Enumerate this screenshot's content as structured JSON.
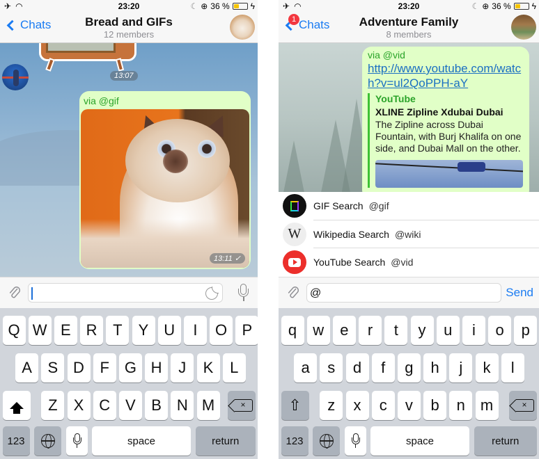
{
  "status_bar": {
    "time": "23:20",
    "battery_text": "36 %",
    "battery_level": 0.36,
    "icons": [
      "airplane-icon",
      "wifi-icon",
      "moon-icon",
      "orientation-lock-icon",
      "battery-icon",
      "charging-icon"
    ]
  },
  "colors": {
    "accent": "#1b7cf2",
    "bubble_out": "#e1ffc7",
    "via_green": "#2aa329",
    "link": "#1b6fc2",
    "badge": "#f3373f",
    "keyboard_bg": "#d1d5db"
  },
  "left": {
    "nav": {
      "back_label": "Chats",
      "title": "Bread and GIFs",
      "subtitle": "12 members"
    },
    "messages": [
      {
        "type": "sticker",
        "time": "13:07"
      },
      {
        "type": "gif",
        "via": "via @gif",
        "time": "13:11",
        "status": "sent-check"
      }
    ],
    "input": {
      "value": "",
      "placeholder": ""
    },
    "keyboard": {
      "row1": [
        "Q",
        "W",
        "E",
        "R",
        "T",
        "Y",
        "U",
        "I",
        "O",
        "P"
      ],
      "row2": [
        "A",
        "S",
        "D",
        "F",
        "G",
        "H",
        "J",
        "K",
        "L"
      ],
      "row3": [
        "Z",
        "X",
        "C",
        "V",
        "B",
        "N",
        "M"
      ],
      "numbers_label": "123",
      "space_label": "space",
      "return_label": "return",
      "shift_state": "on"
    }
  },
  "right": {
    "nav": {
      "back_label": "Chats",
      "unread_badge": "1",
      "title": "Adventure Family",
      "subtitle": "8 members"
    },
    "message": {
      "via": "via @vid",
      "link": "http://www.youtube.com/watch?v=ul2QoPPH-aY",
      "preview": {
        "site": "YouTube",
        "title": "XLINE Zipline Xdubai Dubai",
        "description": "The Zipline across Dubai Fountain, with Burj Khalifa on one side, and Dubai Mall on the other."
      }
    },
    "bots": [
      {
        "name": "GIF Search",
        "handle": "@gif",
        "icon": "gif-search-icon"
      },
      {
        "name": "Wikipedia Search",
        "handle": "@wiki",
        "icon": "wikipedia-icon",
        "glyph": "W"
      },
      {
        "name": "YouTube Search",
        "handle": "@vid",
        "icon": "youtube-icon"
      }
    ],
    "input": {
      "value": "@"
    },
    "send_label": "Send",
    "keyboard": {
      "row1": [
        "q",
        "w",
        "e",
        "r",
        "t",
        "y",
        "u",
        "i",
        "o",
        "p"
      ],
      "row2": [
        "a",
        "s",
        "d",
        "f",
        "g",
        "h",
        "j",
        "k",
        "l"
      ],
      "row3": [
        "z",
        "x",
        "c",
        "v",
        "b",
        "n",
        "m"
      ],
      "numbers_label": "123",
      "space_label": "space",
      "return_label": "return",
      "shift_state": "off"
    }
  }
}
